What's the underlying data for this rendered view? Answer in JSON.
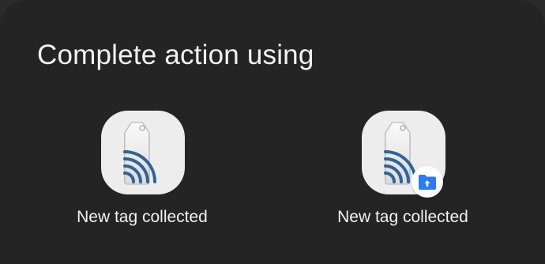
{
  "dialog": {
    "title": "Complete action using"
  },
  "apps": [
    {
      "label": "New tag collected",
      "icon": "nfc-tag-icon",
      "badge": null
    },
    {
      "label": "New tag collected",
      "icon": "nfc-tag-icon",
      "badge": "folder-badge-icon"
    }
  ],
  "colors": {
    "background": "#242424",
    "text": "#f2f2f2",
    "icon_background": "#ededed",
    "tag_blue": "#2f6496",
    "badge_blue": "#2d7bf0"
  }
}
